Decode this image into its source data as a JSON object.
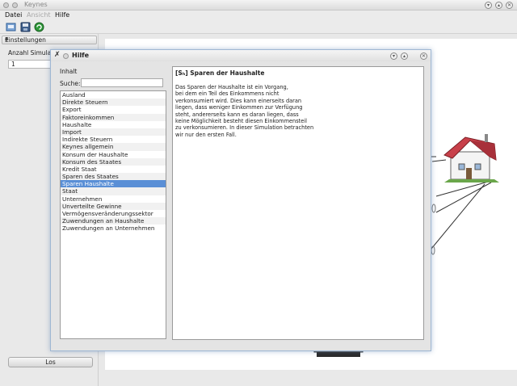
{
  "window": {
    "title": "Keynes"
  },
  "menu": {
    "items": [
      "Datei",
      "Ansicht",
      "Hilfe"
    ]
  },
  "left_panel": {
    "settings_combo": "Einstellungen",
    "sim_label": "Anzahl Simulat",
    "sim_value": "1",
    "run_button": "Los"
  },
  "help": {
    "title": "Hilfe",
    "inhalt_label": "Inhalt",
    "search_label": "Suche:",
    "search_value": "",
    "topics": [
      "Ausland",
      "Direkte Steuern",
      "Export",
      "Faktoreinkommen",
      "Haushalte",
      "Import",
      "Indirekte Steuern",
      "Keynes allgemein",
      "Konsum der Haushalte",
      "Konsum des Staates",
      "Kredit Staat",
      "Sparen des Staates",
      "Sparen Haushalte",
      "Staat",
      "Unternehmen",
      "Unverteilte Gewinne",
      "Vermögensveränderungssektor",
      "Zuwendungen an Haushalte",
      "Zuwendungen an Unternehmen"
    ],
    "selected_index": 12,
    "content_title": "[Sₕ] Sparen der Haushalte",
    "content_text": "Das Sparen der Haushalte ist ein Vorgang,\nbei dem ein Teil des Einkommens nicht\nverkonsumiert wird. Dies kann einerseits daran\nliegen, dass weniger Einkommen zur Verfügung\nsteht, andererseits kann es daran liegen, dass\nkeine Möglichkeit besteht diesen Einkommensteil\nzu verkonsumieren. In dieser Simulation betrachten\nwir nur den ersten Fall."
  },
  "icons": {
    "new": "new-document-icon",
    "save": "save-disk-icon",
    "run": "refresh-green-icon"
  },
  "colors": {
    "selection": "#5a8fd6",
    "dialog_border": "#9fb7d3",
    "roof": "#c8404a"
  }
}
